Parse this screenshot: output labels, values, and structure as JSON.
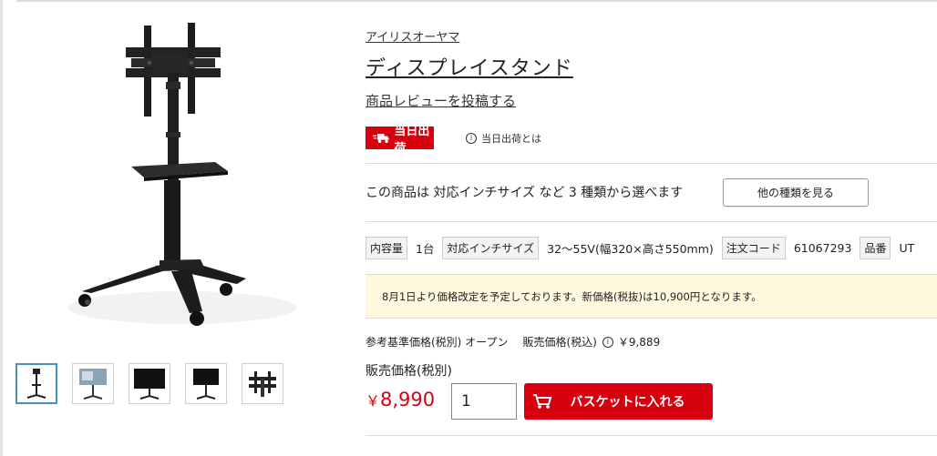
{
  "product": {
    "brand": "アイリスオーヤマ",
    "title": "ディスプレイスタンド",
    "review_link": "商品レビューを投稿する"
  },
  "shipping": {
    "badge_label": "当日出荷",
    "info_label": "当日出荷とは"
  },
  "variants": {
    "text": "この商品は 対応インチサイズ など 3 種類から選べます",
    "button_label": "他の種類を見る"
  },
  "specs": [
    {
      "label": "内容量",
      "value": "1台"
    },
    {
      "label": "対応インチサイズ",
      "value": "32〜55V(幅320×高さ550mm)"
    },
    {
      "label": "注文コード",
      "value": "61067293"
    },
    {
      "label": "品番",
      "value": "UT"
    }
  ],
  "notice": "8月1日より価格改定を予定しております。新価格(税抜)は10,900円となります。",
  "pricing": {
    "reference_label": "参考基準価格(税別) オープン",
    "sale_tax_label": "販売価格(税込)",
    "sale_tax_value": "￥9,889",
    "price_label": "販売価格(税別)",
    "price_currency": "￥",
    "price_value": "8,990"
  },
  "cart": {
    "quantity": "1",
    "button_label": "バスケットに入れる"
  },
  "colors": {
    "accent": "#d7000f",
    "notice_bg": "#fff8df"
  },
  "icons": {
    "truck": "truck-icon",
    "info": "info-icon",
    "cart": "cart-icon"
  }
}
